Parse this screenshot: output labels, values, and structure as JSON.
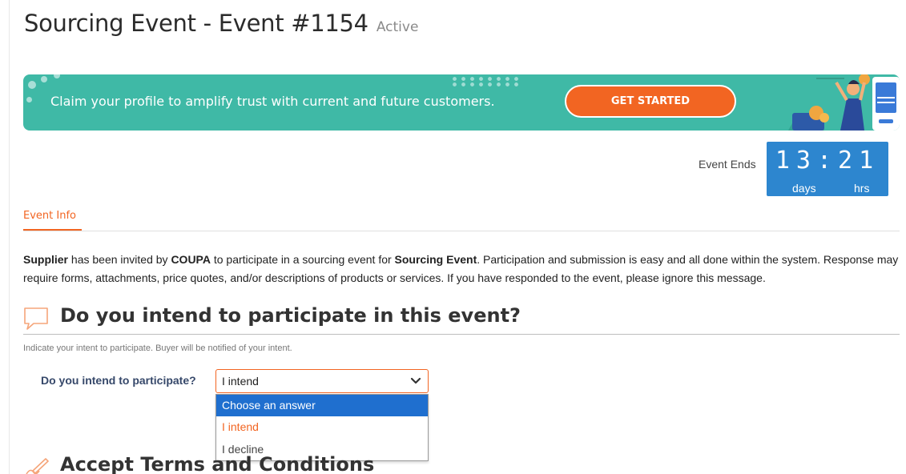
{
  "header": {
    "title": "Sourcing Event - Event #1154",
    "status": "Active"
  },
  "banner": {
    "message": "Claim your profile to amplify trust with current and future customers.",
    "cta_label": "GET STARTED",
    "colors": {
      "background": "#3fb9a6",
      "cta": "#f26522"
    }
  },
  "countdown": {
    "label": "Event Ends",
    "days": "13",
    "separator": ":",
    "hours": "21",
    "days_unit": "days",
    "hours_unit": "hrs",
    "color": "#2d86cf"
  },
  "tabs": [
    {
      "label": "Event Info",
      "active": true
    }
  ],
  "intro": {
    "supplier": "Supplier",
    "part1": " has been invited by ",
    "buyer": "COUPA",
    "part2": " to participate in a sourcing event for ",
    "event_name": "Sourcing Event",
    "part3": ". Participation and submission is easy and all done within the system. Response may require forms, attachments, price quotes, and/or descriptions of products or services. If you have responded to the event, please ignore this message."
  },
  "intent_section": {
    "icon": "speech-bubble-icon",
    "heading": "Do you intend to participate in this event?",
    "hint": "Indicate your intent to participate. Buyer will be notified of your intent.",
    "question_label": "Do you intend to participate?",
    "selected_value": "I intend",
    "options": [
      "Choose an answer",
      "I intend",
      "I decline"
    ],
    "highlighted_option": "Choose an answer"
  },
  "terms_section": {
    "icon": "pen-signature-icon",
    "heading": "Accept Terms and Conditions"
  },
  "accent_color": "#f26522"
}
